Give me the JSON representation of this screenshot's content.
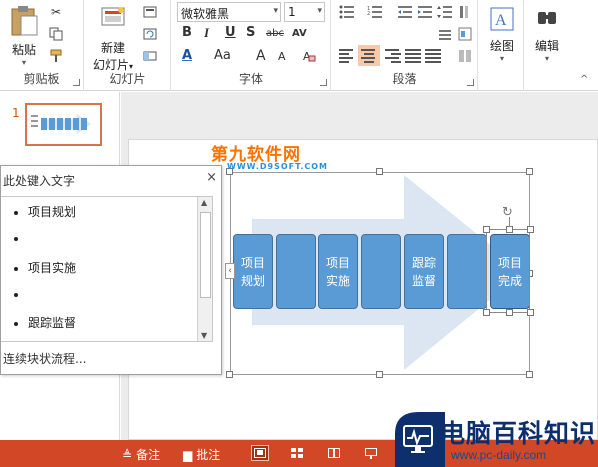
{
  "ribbon": {
    "clipboard": {
      "paste_label": "粘贴",
      "group_label": "剪贴板"
    },
    "slides": {
      "new_slide_label_1": "新建",
      "new_slide_label_2": "幻灯片",
      "group_label": "幻灯片"
    },
    "font": {
      "font_name": "微软雅黑",
      "font_size": "1",
      "bold": "B",
      "italic": "I",
      "underline": "U",
      "shadow": "S",
      "strike": "abc",
      "spacing": "AV",
      "case": "Aa",
      "grow": "A",
      "shrink": "A",
      "color": "A",
      "group_label": "字体"
    },
    "paragraph": {
      "group_label": "段落"
    },
    "drawing": {
      "label": "绘图"
    },
    "editing": {
      "label": "编辑"
    }
  },
  "thumbnails": {
    "slide_number": "1"
  },
  "text_pane": {
    "title": "此处键入文字",
    "close": "×",
    "items": [
      "项目规划",
      "",
      "项目实施",
      "",
      "跟踪监督"
    ],
    "footer_link": "连续块状流程..."
  },
  "smartart": {
    "blocks": [
      {
        "text": "项目\n规划"
      },
      {
        "text": ""
      },
      {
        "text": "项目\n实施"
      },
      {
        "text": ""
      },
      {
        "text": "跟踪\n监督"
      },
      {
        "text": ""
      },
      {
        "text": "项目\n完成"
      }
    ],
    "expand": "‹"
  },
  "statusbar": {
    "notes_label": "备注",
    "comments_label": "批注"
  },
  "watermarks": {
    "site1_title": "第九软件网",
    "site1_url": "WWW.D9SOFT.COM",
    "site2_title": "电脑百科知识",
    "site2_url": "www.pc-daily.com"
  },
  "colors": {
    "accent": "#d24726",
    "block": "#5b9bd5",
    "arrow": "#dce6f2"
  }
}
